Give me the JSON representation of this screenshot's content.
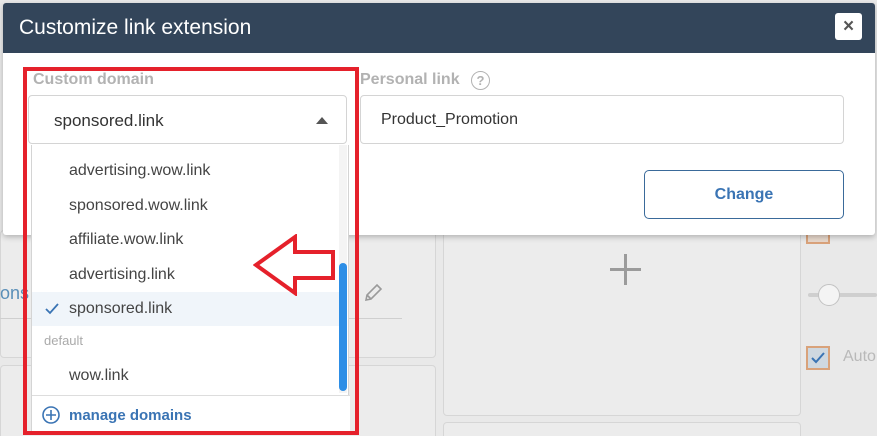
{
  "modal": {
    "title": "Customize link extension",
    "close_label": "×",
    "custom_domain_label": "Custom domain",
    "personal_link_label": "Personal link",
    "help_label": "?",
    "selected_domain": "sponsored.link",
    "personal_link_value": "Product_Promotion",
    "change_button": "Change"
  },
  "dropdown": {
    "items": [
      {
        "label": "advertising.wow.link",
        "selected": false
      },
      {
        "label": "sponsored.wow.link",
        "selected": false
      },
      {
        "label": "affiliate.wow.link",
        "selected": false
      },
      {
        "label": "advertising.link",
        "selected": false
      },
      {
        "label": "sponsored.link",
        "selected": true
      }
    ],
    "group_label": "default",
    "default_items": [
      {
        "label": "wow.link",
        "selected": false
      }
    ],
    "manage_label": "manage domains"
  },
  "background": {
    "partial_heading": "ons",
    "checkbox_label": "Auto"
  },
  "icons": {
    "close": "close-icon",
    "help": "question-circle-icon",
    "caret": "caret-up-icon",
    "check": "check-icon",
    "manage": "plus-circle-icon",
    "pencil": "pencil-icon",
    "plus": "plus-icon"
  },
  "colors": {
    "header_bg": "#33455a",
    "accent": "#3a74b4",
    "scrollbar": "#2d8ee6",
    "annotation": "#e5212b"
  }
}
